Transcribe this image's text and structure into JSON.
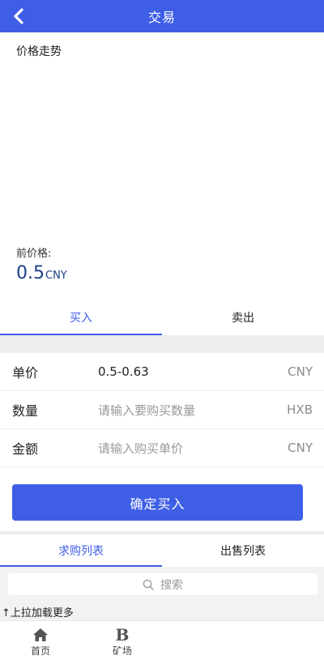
{
  "header": {
    "title": "交易",
    "back_icon": "chevron-left-icon"
  },
  "price": {
    "trend_label": "价格走势",
    "current_label": "前价格:",
    "current_value": "0.5",
    "currency": "CNY"
  },
  "trade_tabs": [
    {
      "label": "买入",
      "active": true
    },
    {
      "label": "卖出",
      "active": false
    }
  ],
  "form": {
    "unit_price": {
      "label": "单价",
      "value": "0.5-0.63",
      "unit": "CNY"
    },
    "quantity": {
      "label": "数量",
      "placeholder": "请输入要购买数量",
      "unit": "HXB"
    },
    "amount": {
      "label": "金额",
      "placeholder": "请输入购买单价",
      "unit": "CNY"
    }
  },
  "confirm_label": "确定买入",
  "list_tabs": [
    {
      "label": "求购列表",
      "active": true
    },
    {
      "label": "出售列表",
      "active": false
    }
  ],
  "search": {
    "placeholder": "搜索",
    "icon": "search-icon"
  },
  "load_more": "↑上拉加载更多",
  "bottom_nav": [
    {
      "label": "首页",
      "icon": "home-icon"
    },
    {
      "label": "矿场",
      "icon": "b-letter-icon",
      "glyph": "B"
    }
  ],
  "colors": {
    "accent": "#3f5ee6",
    "price": "#1d3f8a",
    "gap": "#eeeeee"
  }
}
